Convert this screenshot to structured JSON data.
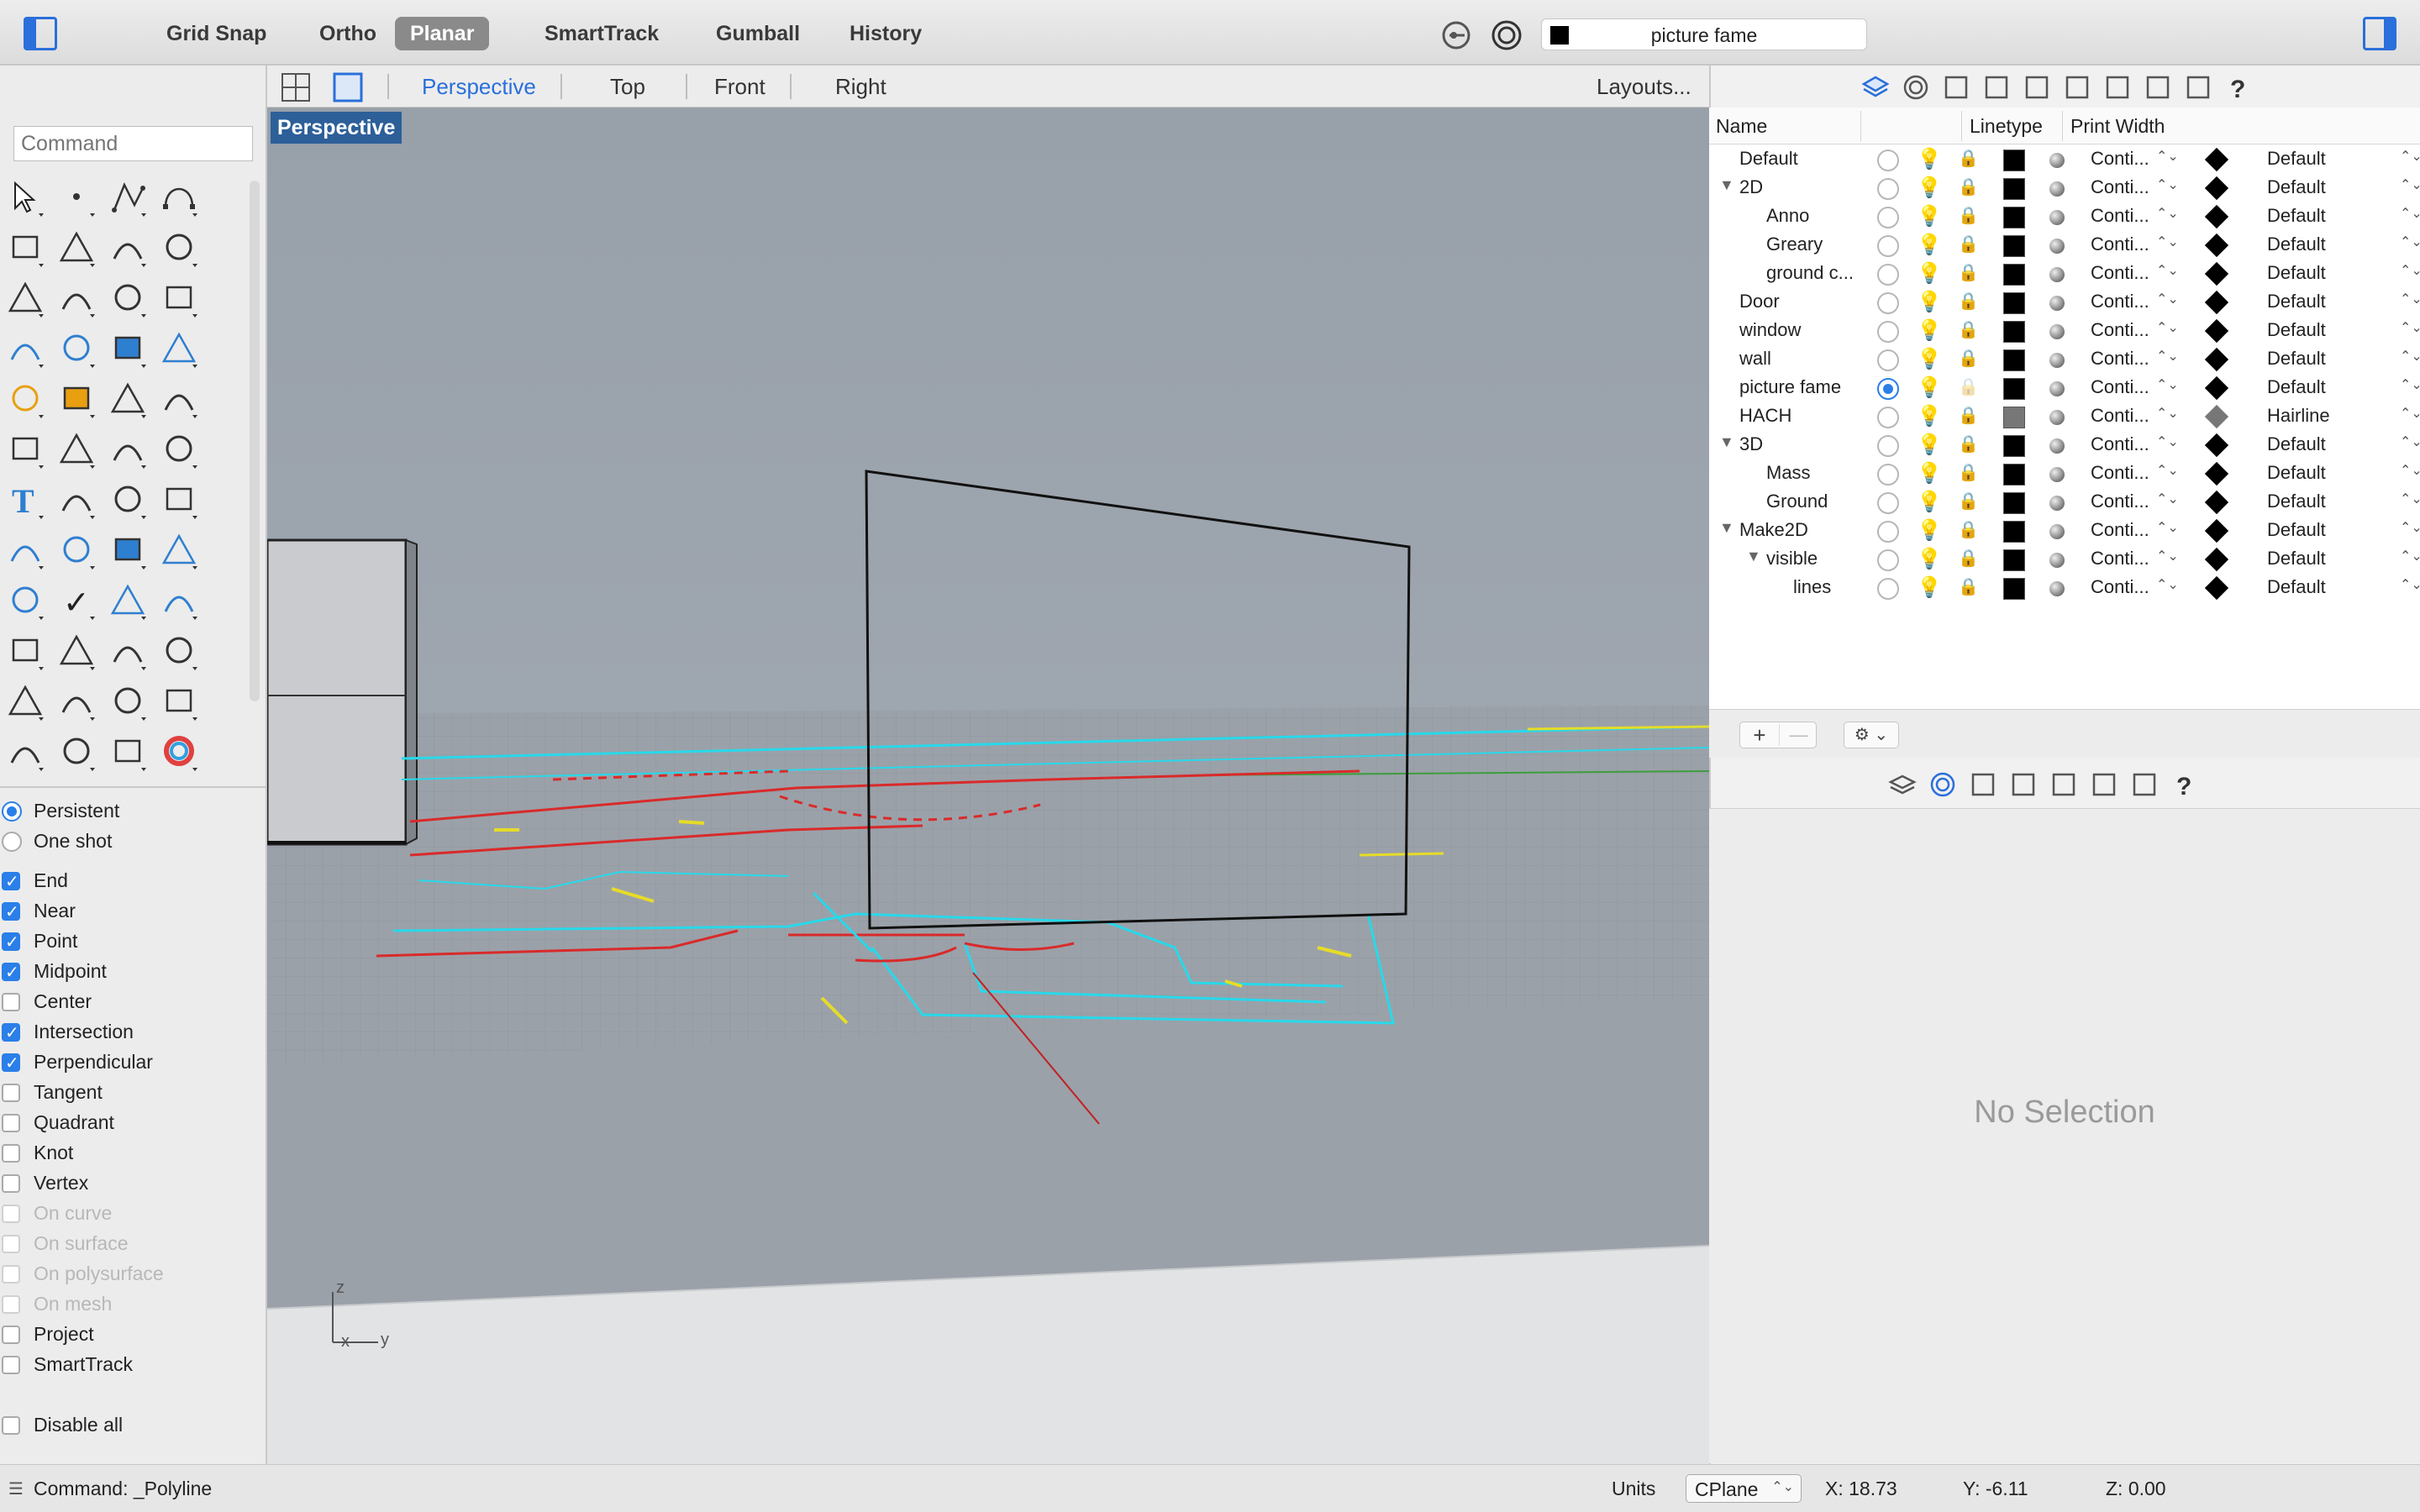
{
  "topbar": {
    "toggles": [
      {
        "label": "Grid Snap",
        "active": false
      },
      {
        "label": "Ortho",
        "active": false
      },
      {
        "label": "Planar",
        "active": true
      },
      {
        "label": "SmartTrack",
        "active": false
      },
      {
        "label": "Gumball",
        "active": false
      },
      {
        "label": "History",
        "active": false
      }
    ],
    "current_layer": "picture fame"
  },
  "viewport_tabs": {
    "tabs": [
      "Perspective",
      "Top",
      "Front",
      "Right"
    ],
    "active": "Perspective",
    "layouts_label": "Layouts..."
  },
  "command": {
    "placeholder": "Command"
  },
  "osnap": {
    "mode": [
      {
        "label": "Persistent",
        "selected": true
      },
      {
        "label": "One shot",
        "selected": false
      }
    ],
    "items": [
      {
        "label": "End",
        "checked": true,
        "enabled": true
      },
      {
        "label": "Near",
        "checked": true,
        "enabled": true
      },
      {
        "label": "Point",
        "checked": true,
        "enabled": true
      },
      {
        "label": "Midpoint",
        "checked": true,
        "enabled": true
      },
      {
        "label": "Center",
        "checked": false,
        "enabled": true
      },
      {
        "label": "Intersection",
        "checked": true,
        "enabled": true
      },
      {
        "label": "Perpendicular",
        "checked": true,
        "enabled": true
      },
      {
        "label": "Tangent",
        "checked": false,
        "enabled": true
      },
      {
        "label": "Quadrant",
        "checked": false,
        "enabled": true
      },
      {
        "label": "Knot",
        "checked": false,
        "enabled": true
      },
      {
        "label": "Vertex",
        "checked": false,
        "enabled": true
      },
      {
        "label": "On curve",
        "checked": false,
        "enabled": false
      },
      {
        "label": "On surface",
        "checked": false,
        "enabled": false
      },
      {
        "label": "On polysurface",
        "checked": false,
        "enabled": false
      },
      {
        "label": "On mesh",
        "checked": false,
        "enabled": false
      },
      {
        "label": "Project",
        "checked": false,
        "enabled": true
      },
      {
        "label": "SmartTrack",
        "checked": false,
        "enabled": true
      }
    ],
    "disable_all": "Disable all"
  },
  "viewport": {
    "label": "Perspective",
    "axis": {
      "z": "z",
      "x": "x",
      "y": "y"
    }
  },
  "layers": {
    "columns": {
      "name": "Name",
      "linetype": "Linetype",
      "print_width": "Print Width"
    },
    "rows": [
      {
        "name": "Default",
        "depth": 0,
        "expander": false,
        "current": false,
        "linetype": "Conti...",
        "print_width": "Default",
        "swatch": "#000000"
      },
      {
        "name": "2D",
        "depth": 0,
        "expander": true,
        "current": false,
        "linetype": "Conti...",
        "print_width": "Default",
        "swatch": "#000000"
      },
      {
        "name": "Anno",
        "depth": 1,
        "expander": false,
        "current": false,
        "linetype": "Conti...",
        "print_width": "Default",
        "swatch": "#000000"
      },
      {
        "name": "Greary",
        "depth": 1,
        "expander": false,
        "current": false,
        "linetype": "Conti...",
        "print_width": "Default",
        "swatch": "#000000"
      },
      {
        "name": "ground c...",
        "depth": 1,
        "expander": false,
        "current": false,
        "linetype": "Conti...",
        "print_width": "Default",
        "swatch": "#000000"
      },
      {
        "name": "Door",
        "depth": 0,
        "expander": false,
        "current": false,
        "linetype": "Conti...",
        "print_width": "Default",
        "swatch": "#000000"
      },
      {
        "name": "window",
        "depth": 0,
        "expander": false,
        "current": false,
        "linetype": "Conti...",
        "print_width": "Default",
        "swatch": "#000000"
      },
      {
        "name": "wall",
        "depth": 0,
        "expander": false,
        "current": false,
        "linetype": "Conti...",
        "print_width": "Default",
        "swatch": "#000000"
      },
      {
        "name": "picture fame",
        "depth": 0,
        "expander": false,
        "current": true,
        "linetype": "Conti...",
        "print_width": "Default",
        "swatch": "#000000"
      },
      {
        "name": "HACH",
        "depth": 0,
        "expander": false,
        "current": false,
        "linetype": "Conti...",
        "print_width": "Hairline",
        "swatch": "#777777"
      },
      {
        "name": "3D",
        "depth": 0,
        "expander": true,
        "current": false,
        "linetype": "Conti...",
        "print_width": "Default",
        "swatch": "#000000"
      },
      {
        "name": "Mass",
        "depth": 1,
        "expander": false,
        "current": false,
        "linetype": "Conti...",
        "print_width": "Default",
        "swatch": "#000000"
      },
      {
        "name": "Ground",
        "depth": 1,
        "expander": false,
        "current": false,
        "linetype": "Conti...",
        "print_width": "Default",
        "swatch": "#000000"
      },
      {
        "name": "Make2D",
        "depth": 0,
        "expander": true,
        "current": false,
        "linetype": "Conti...",
        "print_width": "Default",
        "swatch": "#000000"
      },
      {
        "name": "visible",
        "depth": 1,
        "expander": true,
        "current": false,
        "linetype": "Conti...",
        "print_width": "Default",
        "swatch": "#000000"
      },
      {
        "name": "lines",
        "depth": 2,
        "expander": false,
        "current": false,
        "linetype": "Conti...",
        "print_width": "Default",
        "swatch": "#000000"
      }
    ],
    "add_label": "+",
    "remove_label": "—"
  },
  "properties": {
    "empty_message": "No Selection"
  },
  "status": {
    "command_text": "Command: _Polyline",
    "units_label": "Units",
    "cplane": "CPlane",
    "x": "X: 18.73",
    "y": "Y: -6.11",
    "z": "Z: 0.00"
  }
}
